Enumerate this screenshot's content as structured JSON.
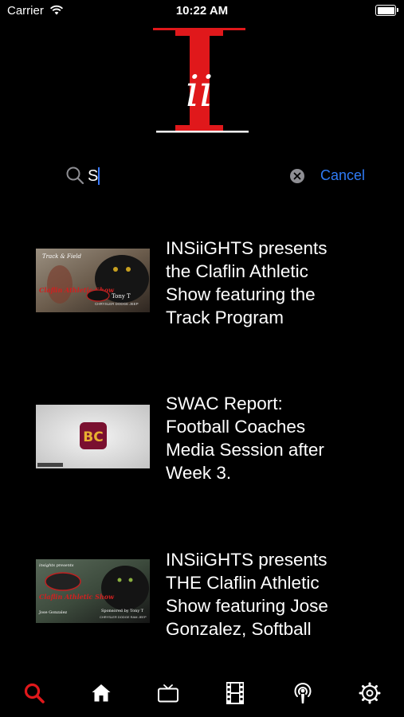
{
  "status": {
    "carrier": "Carrier",
    "time": "10:22 AM"
  },
  "logo": {
    "text": "ii"
  },
  "search": {
    "value": "S",
    "cancel_label": "Cancel"
  },
  "results": [
    {
      "title_lines": [
        "INSiiGHTS presents",
        "the Claflin Athletic",
        "Show featuring the",
        "Track Program"
      ],
      "thumb_text": {
        "top": "Track & Field",
        "main": "Claflin Athletic Show",
        "sponsor": "Tony T",
        "dealer": "CHRYSLER DODGE JEEP"
      }
    },
    {
      "title_lines": [
        "SWAC Report:",
        "Football Coaches",
        "Media Session after",
        "Week 3."
      ],
      "thumb_text": {
        "logo": "BC"
      }
    },
    {
      "title_lines": [
        "INSiiGHTS presents",
        "THE Claflin Athletic",
        "Show featuring Jose",
        "Gonzalez, Softball"
      ],
      "thumb_text": {
        "top": "insights presents",
        "main": "Claflin Athletic Show",
        "guest": "Jose Gonzalez",
        "sponsor": "Sponsored by Tony T",
        "dealer": "CHRYSLER DODGE RAM JEEP"
      }
    }
  ],
  "tabs": [
    {
      "name": "search",
      "active": true
    },
    {
      "name": "home",
      "active": false
    },
    {
      "name": "tv",
      "active": false
    },
    {
      "name": "film",
      "active": false
    },
    {
      "name": "podcast",
      "active": false
    },
    {
      "name": "settings",
      "active": false
    }
  ],
  "colors": {
    "accent_red": "#e0181b",
    "link_blue": "#2f7bf5",
    "background": "#000000"
  }
}
